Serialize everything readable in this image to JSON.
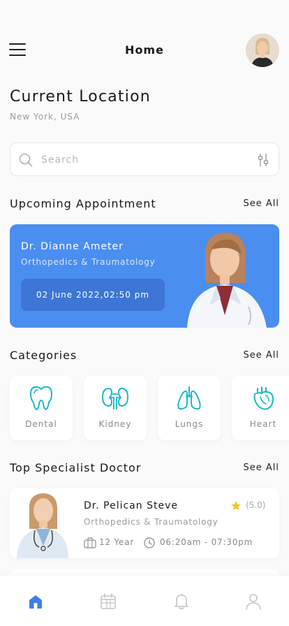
{
  "header": {
    "title": "Home",
    "menu_icon": "hamburger-menu-icon",
    "avatar": "user-avatar"
  },
  "location": {
    "title": "Current Location",
    "value": "New York, USA"
  },
  "search": {
    "placeholder": "Search",
    "value": "",
    "icon": "search-icon",
    "filter_icon": "filter-icon"
  },
  "upcoming": {
    "title": "Upcoming Appointment",
    "see_all": "See All",
    "doctor_name": "Dr. Dianne Ameter",
    "specialty": "Orthopedics & Traumatology",
    "datetime": "02 June 2022,02:50 pm",
    "card_color": "#4a8ef0"
  },
  "categories": {
    "title": "Categories",
    "see_all": "See All",
    "items": [
      {
        "label": "Dental",
        "icon": "tooth-icon"
      },
      {
        "label": "Kidney",
        "icon": "kidney-icon"
      },
      {
        "label": "Lungs",
        "icon": "lungs-icon"
      },
      {
        "label": "Heart",
        "icon": "heart-organ-icon"
      }
    ],
    "icon_color": "#19b8c9"
  },
  "top_doctors": {
    "title": "Top Specialist Doctor",
    "see_all": "See All",
    "doctors": [
      {
        "name": "Dr. Pelican Steve",
        "specialty": "Orthopedics & Traumatology",
        "rating": "(5.0)",
        "experience": "12 Year",
        "hours": "06:20am - 07:30pm"
      }
    ]
  },
  "bottom_nav": {
    "items": [
      {
        "icon": "home-icon",
        "active": true
      },
      {
        "icon": "calendar-icon",
        "active": false
      },
      {
        "icon": "bell-icon",
        "active": false
      },
      {
        "icon": "profile-icon",
        "active": false
      }
    ],
    "active_color": "#3d7eea",
    "inactive_color": "#c4c4c4"
  }
}
